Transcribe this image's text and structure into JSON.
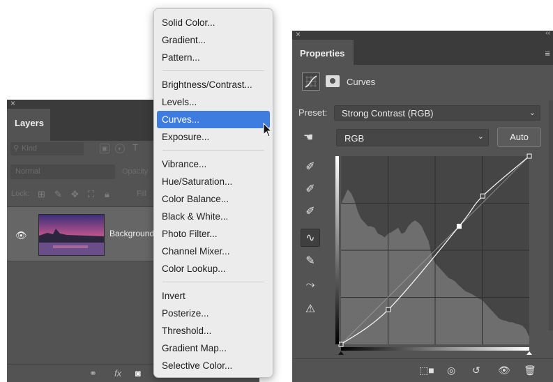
{
  "layers_panel": {
    "close_glyph": "×",
    "tab_label": "Layers",
    "filter_placeholder": "Kind",
    "blend_mode": "Normal",
    "opacity_label": "Opacity",
    "lock_label": "Lock:",
    "fill_label": "Fill",
    "layer_name": "Background"
  },
  "adjustment_menu": {
    "groups": [
      [
        "Solid Color...",
        "Gradient...",
        "Pattern..."
      ],
      [
        "Brightness/Contrast...",
        "Levels...",
        "Curves...",
        "Exposure..."
      ],
      [
        "Vibrance...",
        "Hue/Saturation...",
        "Color Balance...",
        "Black & White...",
        "Photo Filter...",
        "Channel Mixer...",
        "Color Lookup..."
      ],
      [
        "Invert",
        "Posterize...",
        "Threshold...",
        "Gradient Map...",
        "Selective Color..."
      ]
    ],
    "highlighted_item": "Curves...",
    "highlight_color": "#3f7ce0"
  },
  "properties_panel": {
    "close_glyph": "×",
    "collapse_glyph": "‹‹",
    "tab_label": "Properties",
    "adjustment_title": "Curves",
    "preset_label": "Preset:",
    "preset_value": "Strong Contrast (RGB)",
    "channel_value": "RGB",
    "auto_button_label": "Auto",
    "tools": [
      "eyedropper-black-icon",
      "eyedropper-gray-icon",
      "eyedropper-white-icon",
      "curve-points-icon",
      "pencil-icon",
      "smooth-icon",
      "clipping-warning-icon"
    ],
    "footer_icons": [
      "clip-to-layer-icon",
      "view-previous-icon",
      "reset-icon",
      "visibility-icon",
      "delete-icon"
    ]
  },
  "chart_data": {
    "type": "line",
    "x": [
      0,
      64,
      160,
      192,
      255
    ],
    "y": [
      0,
      47,
      160,
      201,
      255
    ],
    "xlim": [
      0,
      255
    ],
    "ylim": [
      0,
      255
    ],
    "grid": true,
    "series": [
      {
        "values": [
          0,
          47,
          160,
          201,
          255
        ]
      }
    ],
    "histogram": [
      190,
      200,
      210,
      205,
      195,
      180,
      170,
      165,
      160,
      160,
      158,
      150,
      148,
      145,
      150,
      152,
      155,
      158,
      150,
      152,
      160,
      165,
      168,
      165,
      160,
      150,
      140,
      120,
      110,
      105,
      100,
      95,
      90,
      88,
      85,
      80,
      76,
      72,
      70,
      68,
      65,
      62,
      60,
      55,
      50,
      45,
      40,
      35,
      33,
      32,
      30,
      30,
      28,
      27,
      25,
      20,
      10
    ]
  }
}
